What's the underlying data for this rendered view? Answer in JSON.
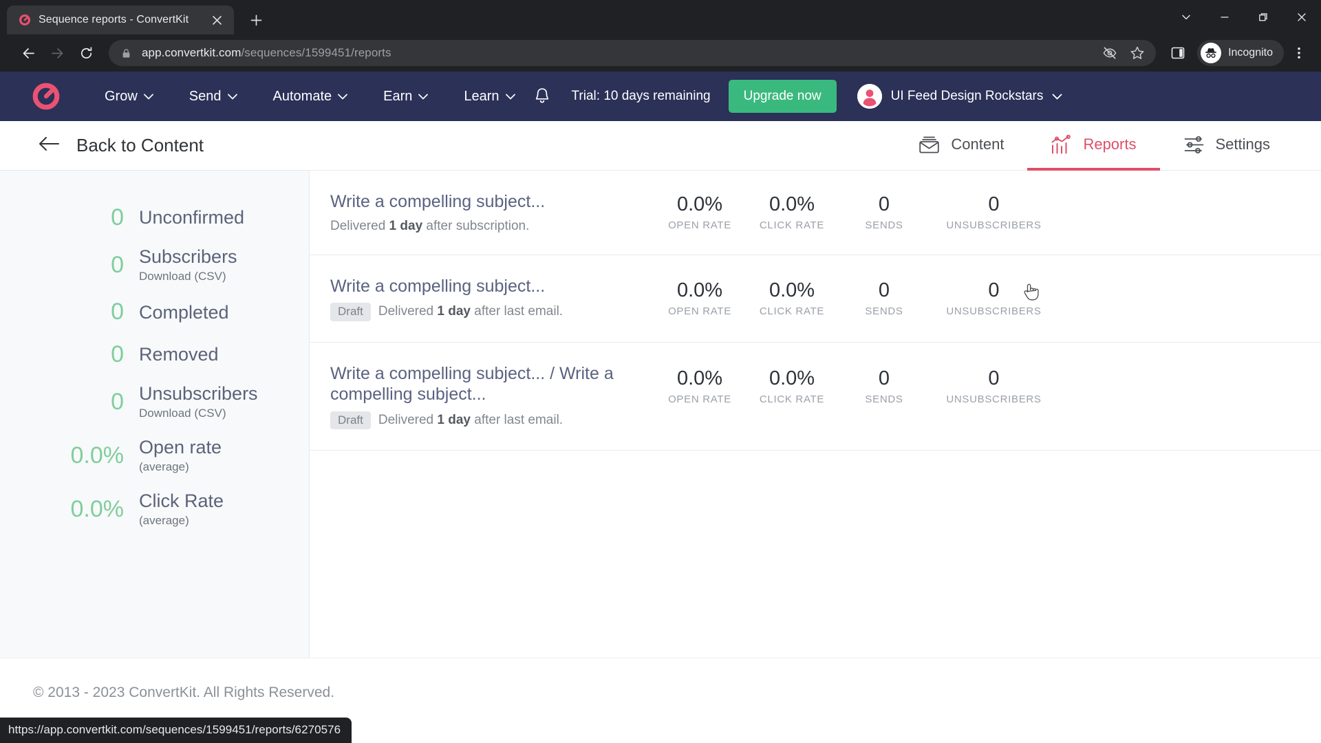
{
  "browser": {
    "tab": {
      "title": "Sequence reports - ConvertKit",
      "favicon_name": "convertkit-logo-icon"
    },
    "new_tab_label": "+",
    "window_controls": [
      "tab-search",
      "minimize",
      "maximize",
      "close"
    ],
    "url_bold": "app.convertkit.com",
    "url_rest": "/sequences/1599451/reports",
    "full_url": "app.convertkit.com/sequences/1599451/reports",
    "profile_label": "Incognito",
    "omni_icons": [
      "third-party-cookie-blocked-icon",
      "bookmark-star-icon"
    ],
    "toolbar_icons": [
      "side-panel-icon",
      "browser-menu-icon"
    ]
  },
  "ck_nav": {
    "logo_name": "convertkit-logo",
    "items": [
      {
        "label": "Grow"
      },
      {
        "label": "Send"
      },
      {
        "label": "Automate"
      },
      {
        "label": "Earn"
      },
      {
        "label": "Learn"
      }
    ],
    "bell_name": "notifications-bell-icon",
    "trial_text": "Trial: 10 days remaining",
    "upgrade_label": "Upgrade now",
    "account_name": "UI Feed Design Rockstars",
    "brand_color": "#2b3157",
    "accent_color": "#e04e67",
    "upgrade_color": "#3ab97f"
  },
  "subheader": {
    "back_label": "Back to Content",
    "tabs": [
      {
        "label": "Content",
        "icon": "envelope-icon",
        "active": false
      },
      {
        "label": "Reports",
        "icon": "chart-icon",
        "active": true
      },
      {
        "label": "Settings",
        "icon": "sliders-icon",
        "active": false
      }
    ]
  },
  "sidebar": {
    "stats": [
      {
        "value": "0",
        "label": "Unconfirmed",
        "sub": ""
      },
      {
        "value": "0",
        "label": "Subscribers",
        "sub": "Download (CSV)"
      },
      {
        "value": "0",
        "label": "Completed",
        "sub": ""
      },
      {
        "value": "0",
        "label": "Removed",
        "sub": ""
      },
      {
        "value": "0",
        "label": "Unsubscribers",
        "sub": "Download (CSV)"
      },
      {
        "value": "0.0%",
        "label": "Open rate",
        "sub": "(average)"
      },
      {
        "value": "0.0%",
        "label": "Click Rate",
        "sub": "(average)"
      }
    ],
    "value_color": "#7fce9c"
  },
  "reports": {
    "metric_labels": [
      "OPEN RATE",
      "CLICK RATE",
      "SENDS",
      "UNSUBSCRIBERS"
    ],
    "rows": [
      {
        "title": "Write a compelling subject...",
        "badge": "",
        "delivery_prefix": "Delivered ",
        "delivery_strong": "1 day",
        "delivery_suffix": " after subscription.",
        "open_rate": "0.0%",
        "click_rate": "0.0%",
        "sends": "0",
        "unsubscribers": "0"
      },
      {
        "title": "Write a compelling subject...",
        "badge": "Draft",
        "delivery_prefix": "Delivered ",
        "delivery_strong": "1 day",
        "delivery_suffix": " after last email.",
        "open_rate": "0.0%",
        "click_rate": "0.0%",
        "sends": "0",
        "unsubscribers": "0"
      },
      {
        "title": "Write a compelling subject... / Write a compelling subject...",
        "badge": "Draft",
        "delivery_prefix": "Delivered ",
        "delivery_strong": "1 day",
        "delivery_suffix": " after last email.",
        "open_rate": "0.0%",
        "click_rate": "0.0%",
        "sends": "0",
        "unsubscribers": "0"
      }
    ]
  },
  "footer": {
    "copyright": "© 2013 - 2023 ConvertKit. All Rights Reserved."
  },
  "statusbar": {
    "url": "https://app.convertkit.com/sequences/1599451/reports/6270576"
  }
}
